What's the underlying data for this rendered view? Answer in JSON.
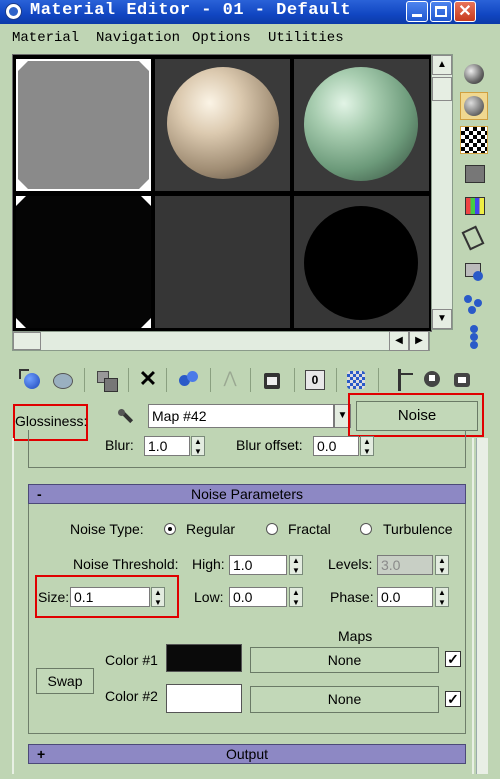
{
  "window": {
    "title": "Material Editor - 01 - Default"
  },
  "menu": [
    "Material",
    "Navigation",
    "Options",
    "Utilities"
  ],
  "map_row": {
    "param_label": "Glossiness:",
    "map_name": "Map #42",
    "map_type_button": "Noise"
  },
  "blur_row": {
    "blur_label": "Blur:",
    "blur_value": "1.0",
    "offset_label": "Blur offset:",
    "offset_value": "0.0"
  },
  "noise_panel": {
    "collapse_symbol": "-",
    "title": "Noise Parameters",
    "noise_type_label": "Noise Type:",
    "types": [
      "Regular",
      "Fractal",
      "Turbulence"
    ],
    "selected_type": "Regular",
    "threshold_label": "Noise Threshold:",
    "high_label": "High:",
    "high_value": "1.0",
    "levels_label": "Levels:",
    "levels_value": "3.0",
    "size_label": "Size:",
    "size_value": "0.1",
    "low_label": "Low:",
    "low_value": "0.0",
    "phase_label": "Phase:",
    "phase_value": "0.0",
    "maps_header": "Maps",
    "swap_label": "Swap",
    "color1_label": "Color #1",
    "color1_hex": "#0a0a0a",
    "color1_map": "None",
    "color2_label": "Color #2",
    "color2_hex": "#ffffff",
    "color2_map": "None"
  },
  "output_panel": {
    "expand_symbol": "+",
    "title": "Output"
  },
  "colors": {
    "panel_bg": "#bfd5b4",
    "highlight_red": "#e00000",
    "rollout_header": "#8d88c4",
    "titlebar_blue": "#1146c2"
  }
}
